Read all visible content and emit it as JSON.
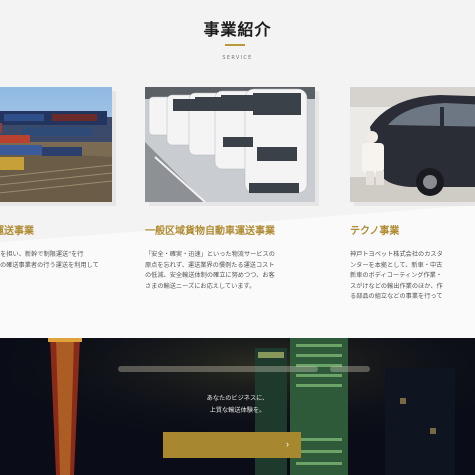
{
  "section": {
    "title": "事業紹介",
    "subtitle": "SERVICE"
  },
  "cards": [
    {
      "heading": "運送事業",
      "lines": [
        "業を担い、新幹で制限運送\"を行",
        "",
        "の確送事業者の行う運送を利用して"
      ]
    },
    {
      "heading": "一般区域貨物自動車運送事業",
      "lines": [
        "「安全・確実・迅速」といった物流サービスの",
        "原点を忘れず、運送業界の慣例たる運送コスト",
        "の低減、安全輸送体制の確立に努めつつ、お客",
        "さまの輸送ニーズにお応えしています。"
      ]
    },
    {
      "heading": "テクノ事業",
      "lines": [
        "神戸トヨペット株式会社のカスタ",
        "ンターを本拠として、新車・中古",
        "新車のボディコーティング作業・",
        "スがけなどの輸出作業のほか、作",
        "る部品の組立などの事業を行って"
      ]
    }
  ],
  "banner": {
    "tagline_1": "あなたのビジネスに、",
    "tagline_2": "上質な輸送体験を。",
    "cta_arrow": "›"
  },
  "colors": {
    "accent": "#b08c35",
    "button": "#a7882f",
    "dark_bg": "#0a0d17"
  }
}
